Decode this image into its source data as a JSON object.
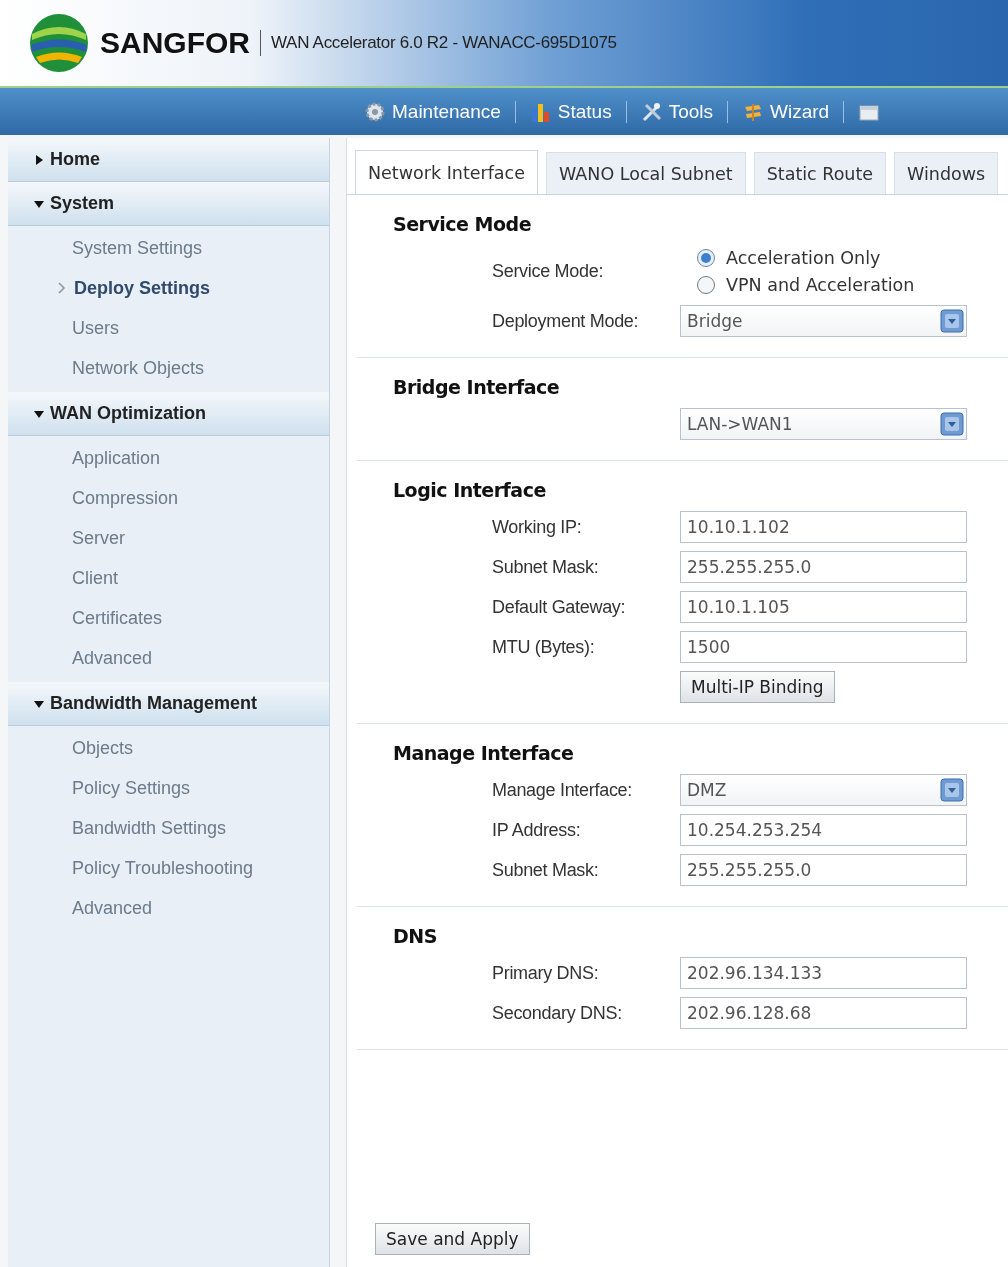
{
  "header": {
    "logo": "SANGFOR",
    "title": "WAN Accelerator 6.0 R2 - WANACC-695D1075"
  },
  "toolbar": [
    {
      "label": "Maintenance"
    },
    {
      "label": "Status"
    },
    {
      "label": "Tools"
    },
    {
      "label": "Wizard"
    }
  ],
  "sidebar": {
    "groups": [
      {
        "label": "Home",
        "expanded": false
      },
      {
        "label": "System",
        "expanded": true,
        "children": [
          {
            "label": "System Settings",
            "selected": false
          },
          {
            "label": "Deploy Settings",
            "selected": true
          },
          {
            "label": "Users",
            "selected": false
          },
          {
            "label": "Network Objects",
            "selected": false
          }
        ]
      },
      {
        "label": "WAN Optimization",
        "expanded": true,
        "children": [
          {
            "label": "Application",
            "selected": false
          },
          {
            "label": "Compression",
            "selected": false
          },
          {
            "label": "Server",
            "selected": false
          },
          {
            "label": "Client",
            "selected": false
          },
          {
            "label": "Certificates",
            "selected": false
          },
          {
            "label": "Advanced",
            "selected": false
          }
        ]
      },
      {
        "label": "Bandwidth Management",
        "expanded": true,
        "children": [
          {
            "label": "Objects",
            "selected": false
          },
          {
            "label": "Policy Settings",
            "selected": false
          },
          {
            "label": "Bandwidth Settings",
            "selected": false
          },
          {
            "label": "Policy Troubleshooting",
            "selected": false
          },
          {
            "label": "Advanced",
            "selected": false
          }
        ]
      }
    ]
  },
  "tabs": [
    {
      "label": "Network Interface",
      "selected": true
    },
    {
      "label": "WANO Local Subnet",
      "selected": false
    },
    {
      "label": "Static Route",
      "selected": false
    },
    {
      "label": "Windows",
      "selected": false
    }
  ],
  "sections": [
    {
      "title": "Service Mode",
      "rows": [
        {
          "kind": "radio",
          "label": "Service Mode:",
          "options": [
            {
              "label": "Acceleration Only",
              "selected": true
            },
            {
              "label": "VPN and Acceleration",
              "selected": false
            }
          ]
        },
        {
          "kind": "select",
          "label": "Deployment Mode:",
          "value": "Bridge"
        }
      ]
    },
    {
      "title": "Bridge Interface",
      "rows": [
        {
          "kind": "select",
          "value": "LAN->WAN1"
        }
      ]
    },
    {
      "title": "Logic Interface",
      "rows": [
        {
          "kind": "text",
          "label": "Working IP:",
          "value": "10.10.1.102"
        },
        {
          "kind": "text",
          "label": "Subnet Mask:",
          "value": "255.255.255.0"
        },
        {
          "kind": "text",
          "label": "Default Gateway:",
          "value": "10.10.1.105"
        },
        {
          "kind": "text",
          "label": "MTU (Bytes):",
          "value": "1500"
        },
        {
          "kind": "button",
          "label": "Multi-IP Binding"
        }
      ]
    },
    {
      "title": "Manage Interface",
      "rows": [
        {
          "kind": "select",
          "label": "Manage Interface:",
          "value": "DMZ"
        },
        {
          "kind": "text",
          "label": "IP Address:",
          "value": "10.254.253.254"
        },
        {
          "kind": "text",
          "label": "Subnet Mask:",
          "value": "255.255.255.0"
        }
      ]
    },
    {
      "title": "DNS",
      "rows": [
        {
          "kind": "text",
          "label": "Primary DNS:",
          "value": "202.96.134.133"
        },
        {
          "kind": "text",
          "label": "Secondary DNS:",
          "value": "202.96.128.68"
        }
      ]
    }
  ],
  "footer": {
    "button": "Save and Apply"
  }
}
